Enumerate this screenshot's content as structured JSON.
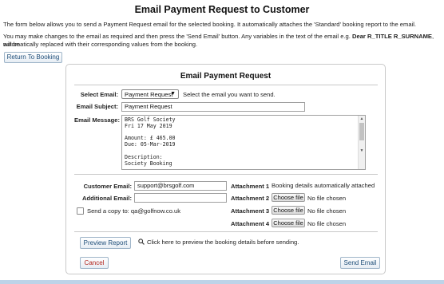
{
  "page": {
    "title": "Email Payment Request to Customer",
    "intro_1": "The form below allows you to send a Payment Request email for the selected booking. It automatically attaches the 'Standard' booking report to the email.",
    "intro_2a": "You may make changes to the email as required and then press the 'Send Email' button. Any variables in the text of the email e.g. ",
    "intro_2_var": "Dear R_TITLE R_SURNAME",
    "intro_2b": ", will be",
    "intro_3": "automatically replaced with their corresponding values from the booking.",
    "return_button": "Return To Booking"
  },
  "panel": {
    "title": "Email Payment Request",
    "select_email_label": "Select Email:",
    "select_email_value": "Payment Request",
    "select_hint": "Select the email you want to send.",
    "subject_label": "Email Subject:",
    "subject_value": "Payment Request",
    "message_label": "Email Message:",
    "message_value": "BRS Golf Society\nFri 17 May 2019\n\nAmount: £ 465.00\nDue: 05-Mar-2019\n\nDescription:\nSociety Booking\n\nReceived with thanks",
    "customer_email_label": "Customer Email:",
    "customer_email_value": "support@brsgolf.com",
    "additional_email_label": "Additional Email:",
    "additional_email_value": "",
    "copy_label": "Send a copy to: qa@golfnow.co.uk",
    "attachments": [
      {
        "label": "Attachment 1",
        "text": "Booking details automatically attached"
      },
      {
        "label": "Attachment 2",
        "button": "Choose file",
        "status": "No file chosen"
      },
      {
        "label": "Attachment 3",
        "button": "Choose file",
        "status": "No file chosen"
      },
      {
        "label": "Attachment 4",
        "button": "Choose file",
        "status": "No file chosen"
      }
    ],
    "preview_button": "Preview Report",
    "preview_hint": "Click here to preview the booking details before sending.",
    "cancel_button": "Cancel",
    "send_button": "Send Email"
  },
  "colors": {
    "accent": "#1f4e79",
    "cancel": "#b3261e",
    "panel_border": "#c9c9c9"
  }
}
